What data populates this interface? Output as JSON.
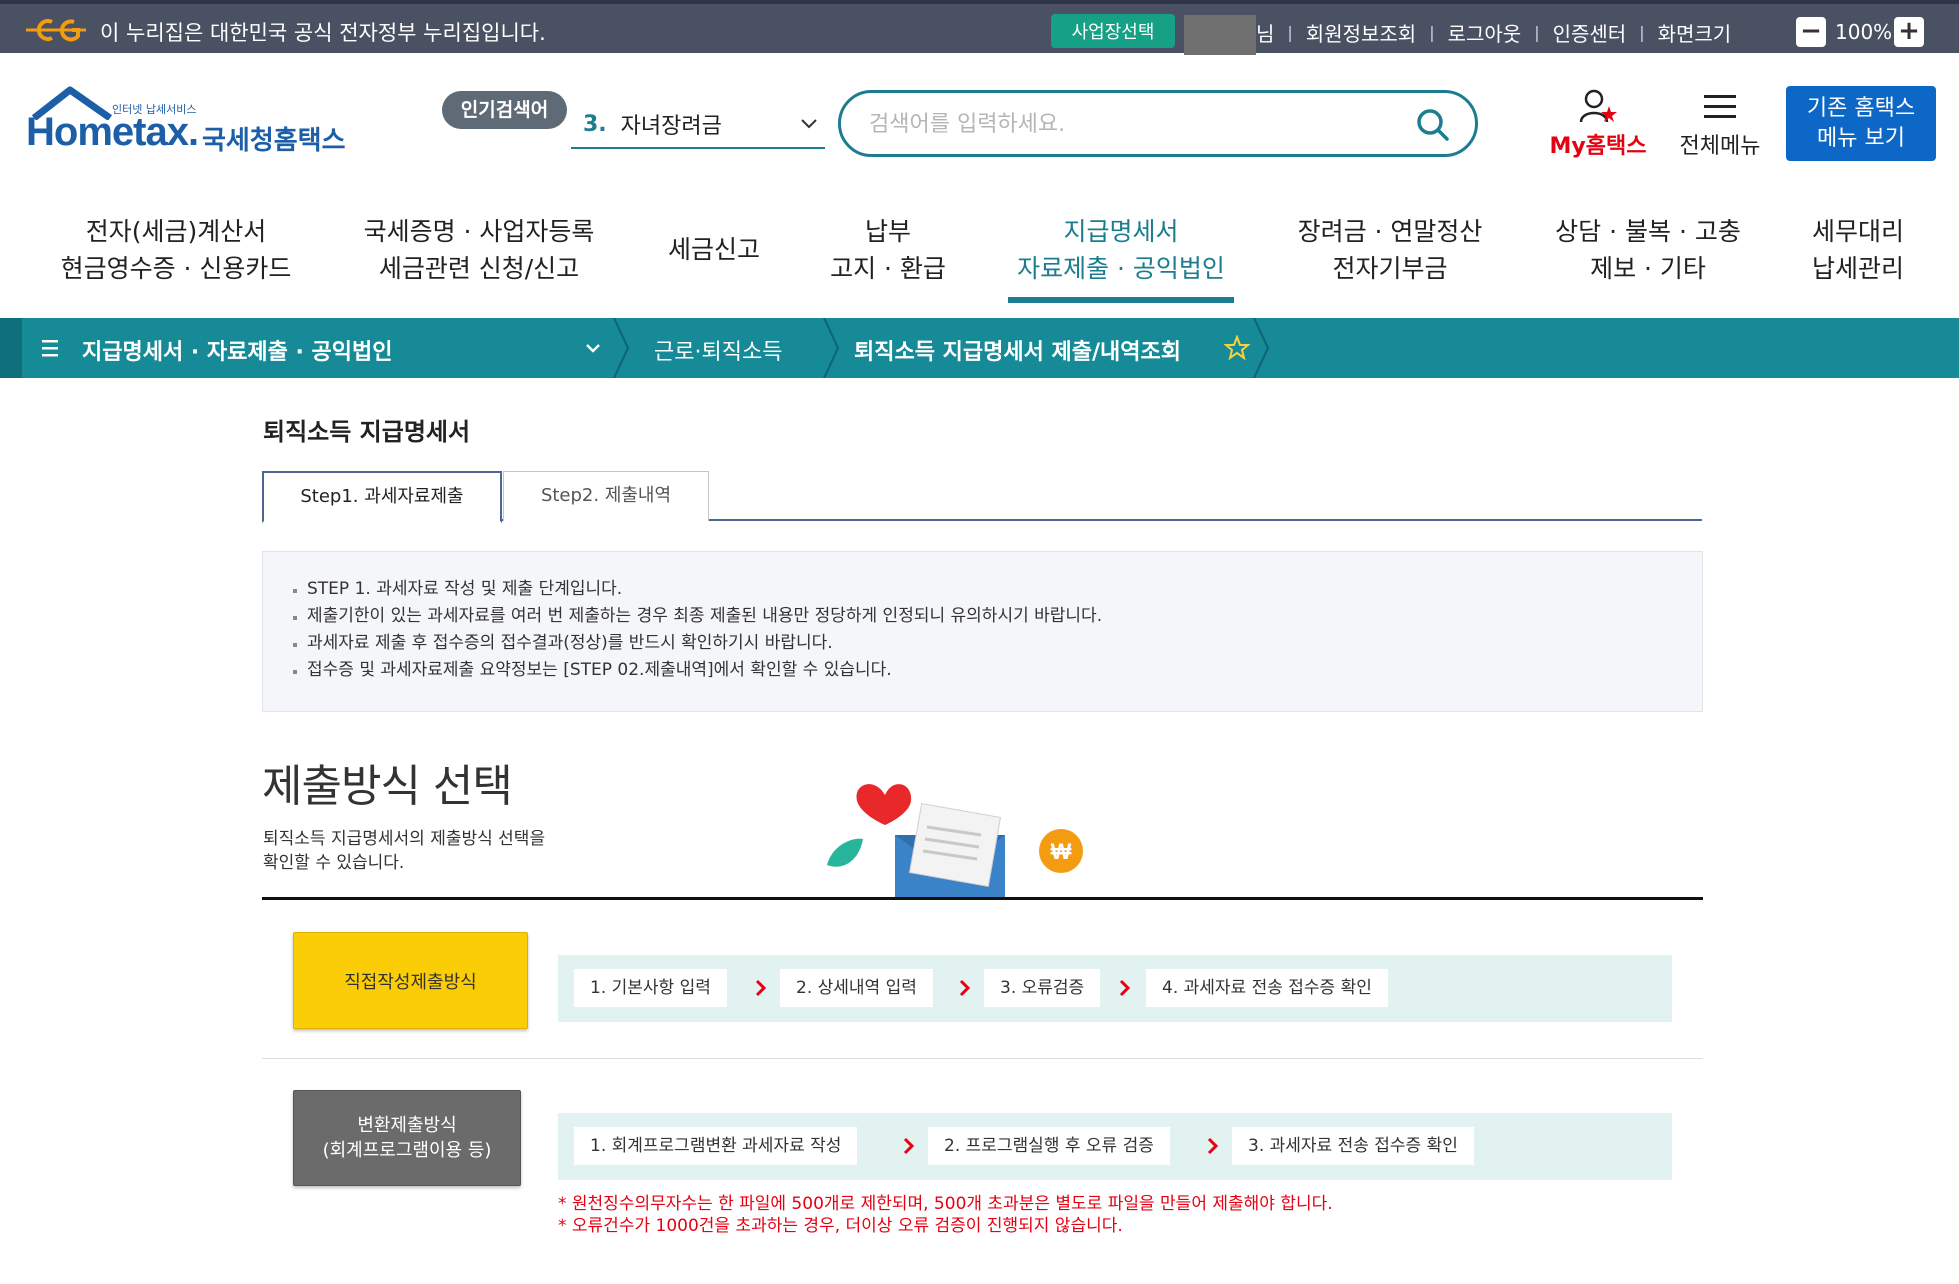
{
  "gov_banner": {
    "text": "이 누리집은 대한민국 공식 전자정부 누리집입니다.",
    "biz_select": "사업장선택",
    "user_suffix": "님",
    "links": [
      "회원정보조회",
      "로그아웃",
      "인증센터",
      "화면크기"
    ],
    "zoom": "100%"
  },
  "header": {
    "logo_small": "인터넷 납세서비스",
    "logo_main": "Hometax.",
    "logo_kr": "국세청홈택스",
    "popular_badge": "인기검색어",
    "popular_num": "3.",
    "popular_term": "자녀장려금",
    "search_placeholder": "검색어를 입력하세요.",
    "my_hometax": "My홈택스",
    "all_menu": "전체메뉴",
    "legacy_button": "기존 홈택스\n메뉴 보기"
  },
  "nav": [
    {
      "l1": "전자(세금)계산서",
      "l2": "현금영수증 · 신용카드"
    },
    {
      "l1": "국세증명 · 사업자등록",
      "l2": "세금관련 신청/신고"
    },
    {
      "l1": "세금신고",
      "l2": ""
    },
    {
      "l1": "납부",
      "l2": "고지 · 환급"
    },
    {
      "l1": "지급명세서",
      "l2": "자료제출 · 공익법인"
    },
    {
      "l1": "장려금 · 연말정산",
      "l2": "전자기부금"
    },
    {
      "l1": "상담 · 불복 · 고충",
      "l2": "제보 · 기타"
    },
    {
      "l1": "세무대리",
      "l2": "납세관리"
    }
  ],
  "breadcrumb": {
    "level1": "지급명세서 · 자료제출 · 공익법인",
    "level2": "근로·퇴직소득",
    "level3": "퇴직소득 지급명세서 제출/내역조회"
  },
  "page": {
    "title": "퇴직소득 지급명세서",
    "tabs": [
      "Step1. 과세자료제출",
      "Step2. 제출내역"
    ],
    "info": [
      "STEP 1. 과세자료 작성 및 제출 단계입니다.",
      "제출기한이 있는 과세자료를 여러 번 제출하는 경우 최종 제출된 내용만 정당하게 인정되니 유의하시기 바랍니다.",
      "과세자료 제출 후 접수증의 접수결과(정상)를 반드시 확인하기시 바랍니다.",
      "접수증 및 과세자료제출 요약정보는 [STEP 02.제출내역]에서 확인할 수 있습니다."
    ],
    "method_title": "제출방식 선택",
    "method_desc": "퇴직소득 지급명세서의 제출방식 선택을\n확인할 수 있습니다.",
    "direct_button": "직접작성제출방식",
    "direct_steps": [
      "1. 기본사항 입력",
      "2. 상세내역 입력",
      "3. 오류검증",
      "4. 과세자료 전송 접수증 확인"
    ],
    "convert_button": "변환제출방식\n(회계프로그램이용 등)",
    "convert_steps": [
      "1. 회계프로그램변환 과세자료 작성",
      "2. 프로그램실행 후 오류 검증",
      "3. 과세자료 전송 접수증 확인"
    ],
    "notes": [
      "* 원천징수의무자수는 한 파일에 500개로 제한되며, 500개 초과분은 별도로 파일을 만들어 제출해야 합니다.",
      "* 오류건수가 1000건을 초과하는 경우, 더이상 오류 검증이 진행되지 않습니다."
    ]
  },
  "colors": {
    "gov_bar": "#4a5163",
    "accent_teal": "#1b7d8f",
    "crumb_bar": "#168a97",
    "legacy_blue": "#0d67c7",
    "direct_yellow": "#fbcd06",
    "note_red": "#e60012"
  },
  "icons": [
    "eg-gov-logo",
    "chevron-down-icon",
    "search-icon",
    "user-icon",
    "hamburger-icon",
    "star-icon",
    "arrow-right-icon"
  ]
}
